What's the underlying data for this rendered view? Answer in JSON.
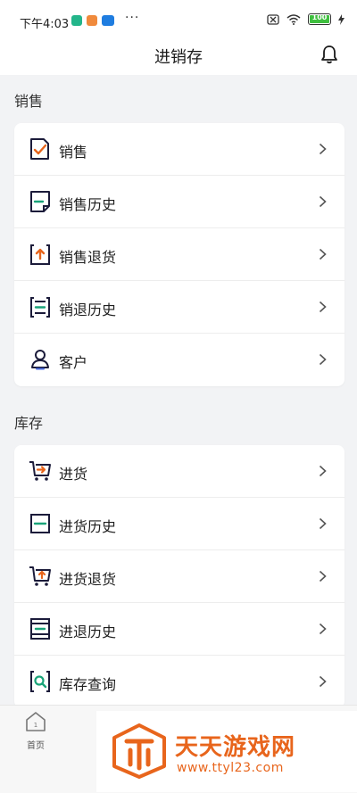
{
  "status_bar": {
    "time": "下午4:03",
    "dots": "···",
    "battery": "100"
  },
  "header": {
    "title": "进销存"
  },
  "sections": [
    {
      "title": "销售",
      "items": [
        {
          "label": "销售",
          "icon": "sales-doc-icon"
        },
        {
          "label": "销售历史",
          "icon": "sales-history-icon"
        },
        {
          "label": "销售退货",
          "icon": "sales-return-icon"
        },
        {
          "label": "销退历史",
          "icon": "sales-return-history-icon"
        },
        {
          "label": "客户",
          "icon": "customer-icon"
        }
      ]
    },
    {
      "title": "库存",
      "items": [
        {
          "label": "进货",
          "icon": "purchase-cart-icon"
        },
        {
          "label": "进货历史",
          "icon": "purchase-history-icon"
        },
        {
          "label": "进货退货",
          "icon": "purchase-return-cart-icon"
        },
        {
          "label": "进退历史",
          "icon": "purchase-return-history-icon"
        },
        {
          "label": "库存查询",
          "icon": "inventory-search-icon"
        }
      ]
    }
  ],
  "tabbar": {
    "home_label": "首页",
    "home_badge": "1"
  },
  "watermark": {
    "name": "天天游戏网",
    "url": "www.ttyl23.com"
  },
  "colors": {
    "accent_orange": "#e8651c",
    "accent_green": "#1aa37a",
    "icon_dark": "#1b1b3a"
  }
}
